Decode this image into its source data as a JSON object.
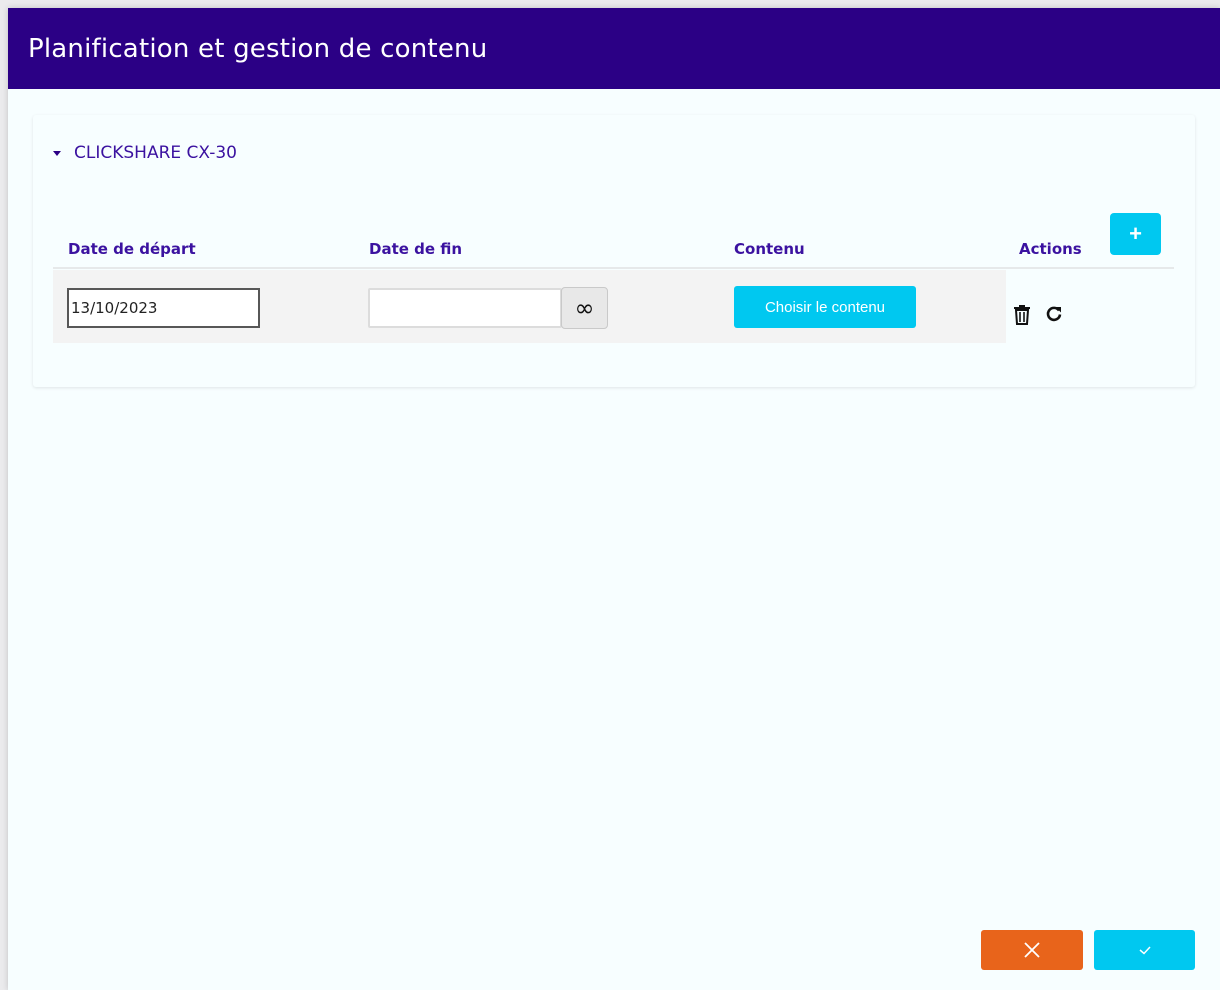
{
  "dialog": {
    "title": "Planification et gestion de contenu"
  },
  "section": {
    "title": "CLICKSHARE CX-30",
    "expanded": true
  },
  "table": {
    "headers": {
      "start": "Date de départ",
      "end": "Date de fin",
      "content": "Contenu",
      "actions": "Actions"
    },
    "add_label": "+",
    "rows": [
      {
        "start_date": "13/10/2023",
        "end_date": "",
        "infinite_label": "∞",
        "choose_content_label": "Choisir le contenu"
      }
    ]
  },
  "icons": {
    "add": "plus-icon",
    "infinite": "infinity-icon",
    "delete": "trash-icon",
    "reset": "refresh-icon",
    "cancel": "close-icon",
    "confirm": "check-icon"
  },
  "colors": {
    "header": "#2b0085",
    "accent": "#00c8f0",
    "cancel": "#e8641b",
    "label": "#3b12a0"
  }
}
